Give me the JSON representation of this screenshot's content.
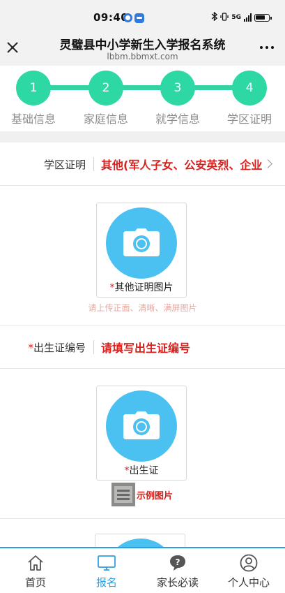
{
  "status_bar": {
    "time": "09:40",
    "network": "5G"
  },
  "header": {
    "title": "灵璧县中小学新生入学报名系统",
    "url": "lbbm.bbmxt.com"
  },
  "stepper": {
    "steps": [
      {
        "number": "1",
        "label": "基础信息"
      },
      {
        "number": "2",
        "label": "家庭信息"
      },
      {
        "number": "3",
        "label": "就学信息"
      },
      {
        "number": "4",
        "label": "学区证明"
      }
    ]
  },
  "form": {
    "district_proof": {
      "label": "学区证明",
      "value": "其他(军人子女、公安英烈、企业"
    },
    "other_proof_upload": {
      "required_mark": "*",
      "caption": "其他证明图片",
      "hint": "请上传正面、清晰、满屏图片"
    },
    "birth_cert_number": {
      "required_mark": "*",
      "label": "出生证编号",
      "placeholder": "请填写出生证编号"
    },
    "birth_cert_upload": {
      "required_mark": "*",
      "caption": "出生证",
      "example_label": "示例图片"
    }
  },
  "colors": {
    "step_active": "#2ed8a5",
    "upload_circle": "#4bc1f2",
    "accent_red": "#d9201d",
    "nav_active": "#2d9fe3"
  },
  "bottom_nav": {
    "items": [
      {
        "label": "首页",
        "icon": "home-icon"
      },
      {
        "label": "报名",
        "icon": "monitor-icon"
      },
      {
        "label": "家长必读",
        "icon": "help-icon"
      },
      {
        "label": "个人中心",
        "icon": "user-icon"
      }
    ],
    "active_index": 1
  }
}
